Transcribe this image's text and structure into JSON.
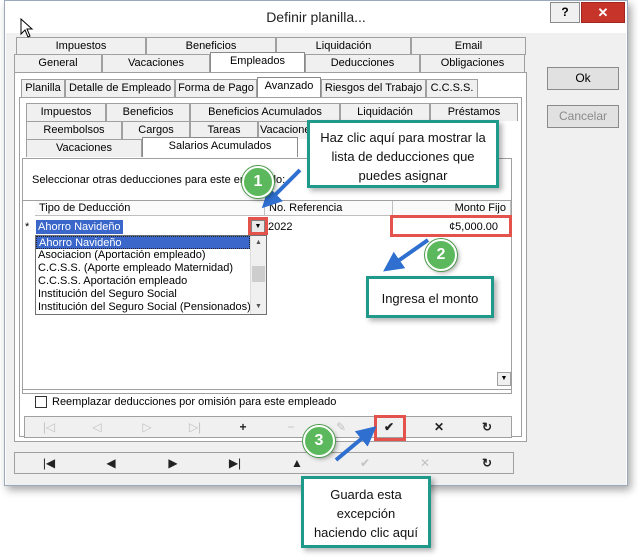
{
  "window": {
    "title": "Definir planilla...",
    "help_label": "?",
    "close_label": "✕"
  },
  "tabs_row1": [
    "Impuestos",
    "Beneficios",
    "Liquidación",
    "Email"
  ],
  "tabs_row2": [
    "General",
    "Vacaciones",
    "Empleados",
    "Deducciones",
    "Obligaciones"
  ],
  "tabs_row3": [
    "Planilla",
    "Detalle de Empleado",
    "Forma de Pago",
    "Avanzado",
    "Riesgos del Trabajo",
    "C.C.S.S."
  ],
  "tabs_row4": [
    "Impuestos",
    "Beneficios",
    "Beneficios Acumulados",
    "Liquidación",
    "Préstamos"
  ],
  "tabs_row5": [
    "Reembolsos",
    "Cargos",
    "Tareas",
    "Vacaciones"
  ],
  "tabs_row6": [
    "Vacaciones",
    "Salarios Acumulados"
  ],
  "prompt": "Seleccionar otras deducciones para este empleado:",
  "grid": {
    "columns": [
      "Tipo de Deducción",
      "No. Referencia",
      "Monto Fijo"
    ],
    "row_marker": "*",
    "row": {
      "tipo": "Ahorro Navideño",
      "referencia": "2022",
      "monto": "¢5,000.00"
    }
  },
  "dropdown_options": [
    "Ahorro Navideño",
    "Asociacion (Aportación empleado)",
    "C.C.S.S. (Aporte empleado Maternidad)",
    "C.C.S.S. Aportación empleado",
    "Institución del Seguro Social",
    "Institución del Seguro Social (Pensionados)"
  ],
  "checkbox_label": "Reemplazar deducciones por omisión para este empleado",
  "side_buttons": {
    "ok": "Ok",
    "cancel": "Cancelar"
  },
  "callouts": {
    "c1": "Haz clic aquí para mostrar la lista de deducciones que puedes asignar",
    "c2": "Ingresa el monto",
    "c3": "Guarda esta excepción haciendo clic aquí"
  },
  "badges": [
    "1",
    "2",
    "3"
  ],
  "colors": {
    "highlight": "#e3524b",
    "callout_border": "#1f9a8a",
    "badge": "#5cb85c",
    "selection": "#3a67c9"
  }
}
